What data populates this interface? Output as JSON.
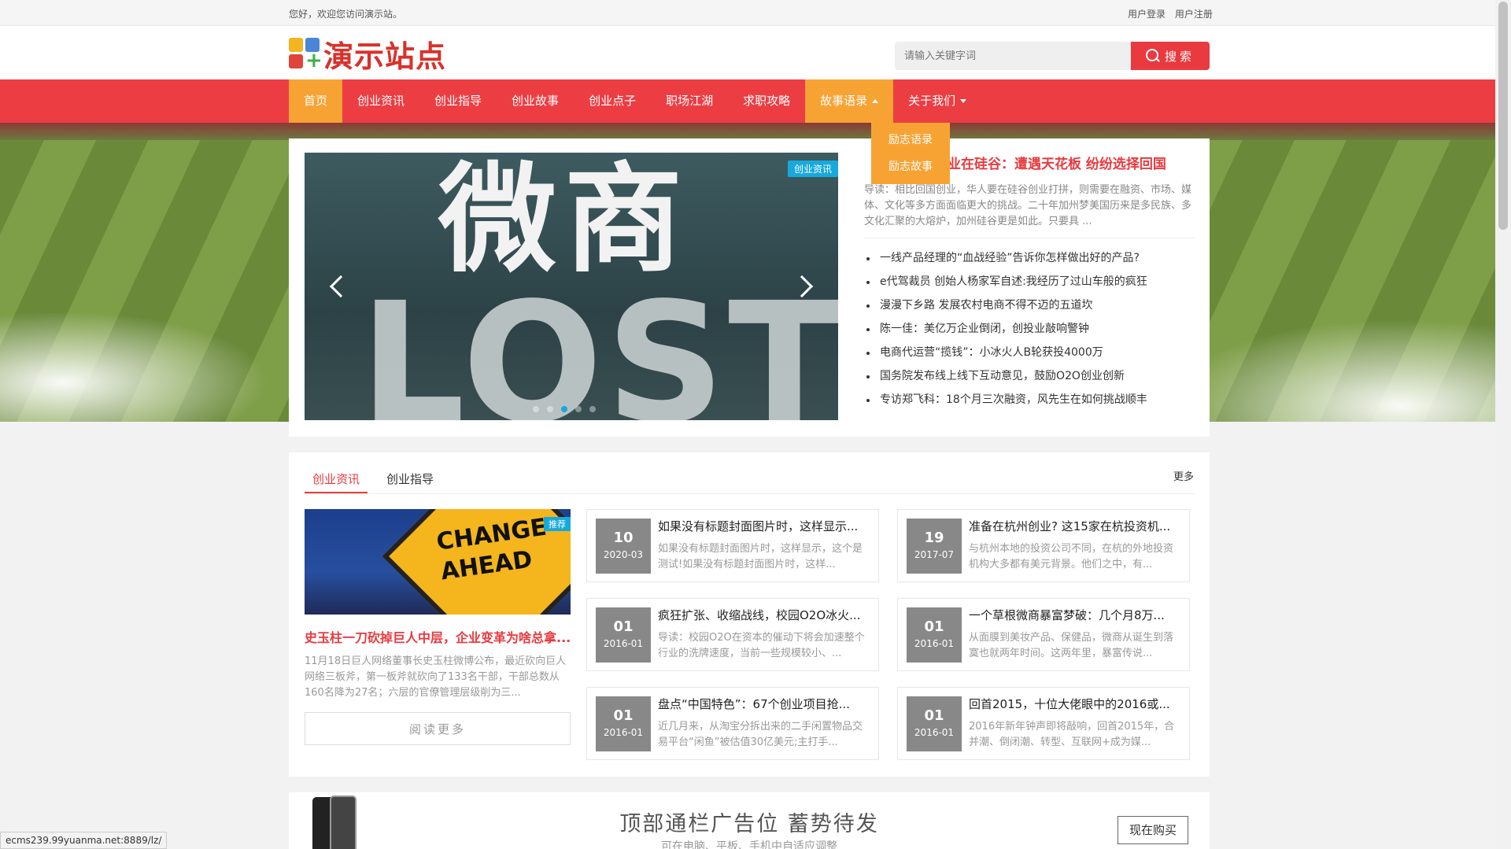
{
  "topbar": {
    "welcome": "您好，欢迎您访问演示站。",
    "login": "用户登录",
    "register": "用户注册"
  },
  "header": {
    "logo_text": "演示站点",
    "search_placeholder": "请输入关键字词",
    "search_button": "搜索"
  },
  "nav": {
    "items": [
      "首页",
      "创业资讯",
      "创业指导",
      "创业故事",
      "创业点子",
      "职场江湖",
      "求职攻略",
      "故事语录",
      "关于我们"
    ],
    "dropdown": [
      "励志语录",
      "励志故事"
    ]
  },
  "hero": {
    "slide_tag": "创业资讯",
    "slide_text_top": "微商",
    "slide_text_bottom": "LOST",
    "headline_title": "业在硅谷：遭遇天花板 纷纷选择回国",
    "headline_summary": "导读：相比回国创业，华人要在硅谷创业打拼，则需要在融资、市场、媒体、文化等多方面面临更大的挑战。二十年加州梦美国历来是多民族、多文化汇聚的大熔炉，加州硅谷更是如此。只要具 ...",
    "list": [
      "一线产品经理的“血战经验”告诉你怎样做出好的产品?",
      "e代驾裁员 创始人杨家军自述:我经历了过山车般的疯狂",
      "漫漫下乡路 发展农村电商不得不迈的五道坎",
      "陈一佳：美亿万企业倒闭，创投业敲响警钟",
      "电商代运营“揽钱”：小冰火人B轮获投4000万",
      "国务院发布线上线下互动意见，鼓励O2O创业创新",
      "专访郑飞科：18个月三次融资，风先生在如何挑战顺丰"
    ]
  },
  "news": {
    "tabs": [
      "创业资讯",
      "创业指导"
    ],
    "more": "更多",
    "feature": {
      "badge": "推荐",
      "img_text_1": "CHANGE",
      "img_text_2": "AHEAD",
      "title": "史玉柱一刀砍掉巨人中层，企业变革为啥总拿...",
      "summary": "11月18日巨人网络董事长史玉柱微博公布，最近砍向巨人网络三板斧，第一板斧就砍向了133名干部，干部总数从160名降为27名；六层的官僚管理层级削为三...",
      "button": "阅读更多"
    },
    "cards": [
      {
        "day": "10",
        "ym": "2020-03",
        "title": "如果没有标题封面图片时，这样显示...",
        "summary": "如果没有标题封面图片时，这样显示，这个是测试!如果没有标题封面图片时，这样..."
      },
      {
        "day": "19",
        "ym": "2017-07",
        "title": "准备在杭州创业? 这15家在杭投资机...",
        "summary": "与杭州本地的投资公司不同，在杭的外地投资机构大多都有美元背景。他们之中，有..."
      },
      {
        "day": "01",
        "ym": "2016-01",
        "title": "疯狂扩张、收缩战线，校园O2O冰火...",
        "summary": "导读：校园O2O在资本的催动下将会加速整个行业的洗牌速度，当前一些规模较小、..."
      },
      {
        "day": "01",
        "ym": "2016-01",
        "title": "一个草根微商暴富梦破：几个月8万...",
        "summary": "从面膜到美妆产品、保健品，微商从诞生到落寞也就两年时间。这两年里，暴富传说..."
      },
      {
        "day": "01",
        "ym": "2016-01",
        "title": "盘点“中国特色”：67个创业项目抢...",
        "summary": "近几月来，从淘宝分拆出来的二手闲置物品交易平台“闲鱼”被估值30亿美元;主打手..."
      },
      {
        "day": "01",
        "ym": "2016-01",
        "title": "回首2015，十位大佬眼中的2016或...",
        "summary": "2016年新年钟声即将敲响，回首2015年，合并潮、倒闭潮、转型、互联网+成为媒..."
      }
    ]
  },
  "ad": {
    "title": "顶部通栏广告位 蓄势待发",
    "subtitle": "可在电脑、平板、手机中自适应调整",
    "button": "现在购买"
  },
  "status_url": "ecms239.99yuanma.net:8889/lz/"
}
